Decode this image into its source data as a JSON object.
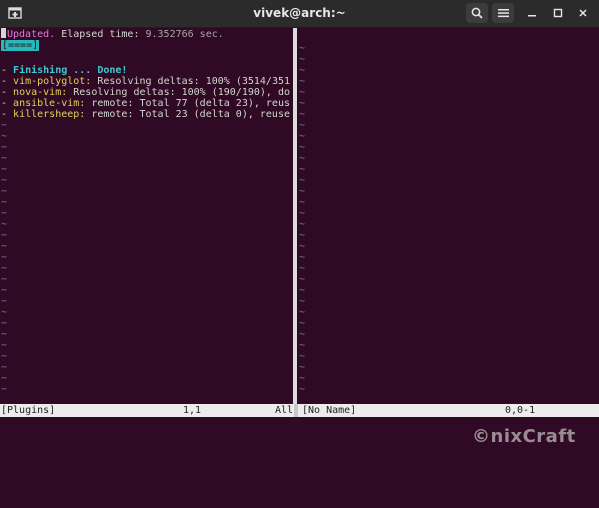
{
  "window": {
    "title": "vivek@arch:~"
  },
  "left_pane": {
    "header": {
      "updated": "Updated.",
      "elapsed_label": " Elapsed time:",
      "elapsed_value": " 9.352766 sec.",
      "progress": "[====]"
    },
    "log": [
      {
        "dash": "- ",
        "name": "Finishing ... Done!",
        "rest": ""
      },
      {
        "dash": "- ",
        "name": "vim-polyglot:",
        "rest": " Resolving deltas: 100% (3514/351"
      },
      {
        "dash": "- ",
        "name": "nova-vim:",
        "rest": " Resolving deltas: 100% (190/190), do"
      },
      {
        "dash": "- ",
        "name": "ansible-vim:",
        "rest": " remote: Total 77 (delta 23), reus"
      },
      {
        "dash": "- ",
        "name": "killersheep:",
        "rest": " remote: Total 23 (delta 0), reuse"
      }
    ],
    "tilde": "~"
  },
  "right_pane": {
    "tilde": "~"
  },
  "statusbar": {
    "left_name": "[Plugins]",
    "left_pos": "1,1",
    "left_all": "All",
    "right_name": "[No Name]",
    "right_pos": "0,0-1"
  },
  "watermark": "©nixCraft",
  "icons": {
    "new_tab": "new-tab-icon",
    "search": "search-icon",
    "menu": "hamburger-menu-icon",
    "minimize": "minimize-icon",
    "maximize": "maximize-icon",
    "close": "close-icon"
  }
}
